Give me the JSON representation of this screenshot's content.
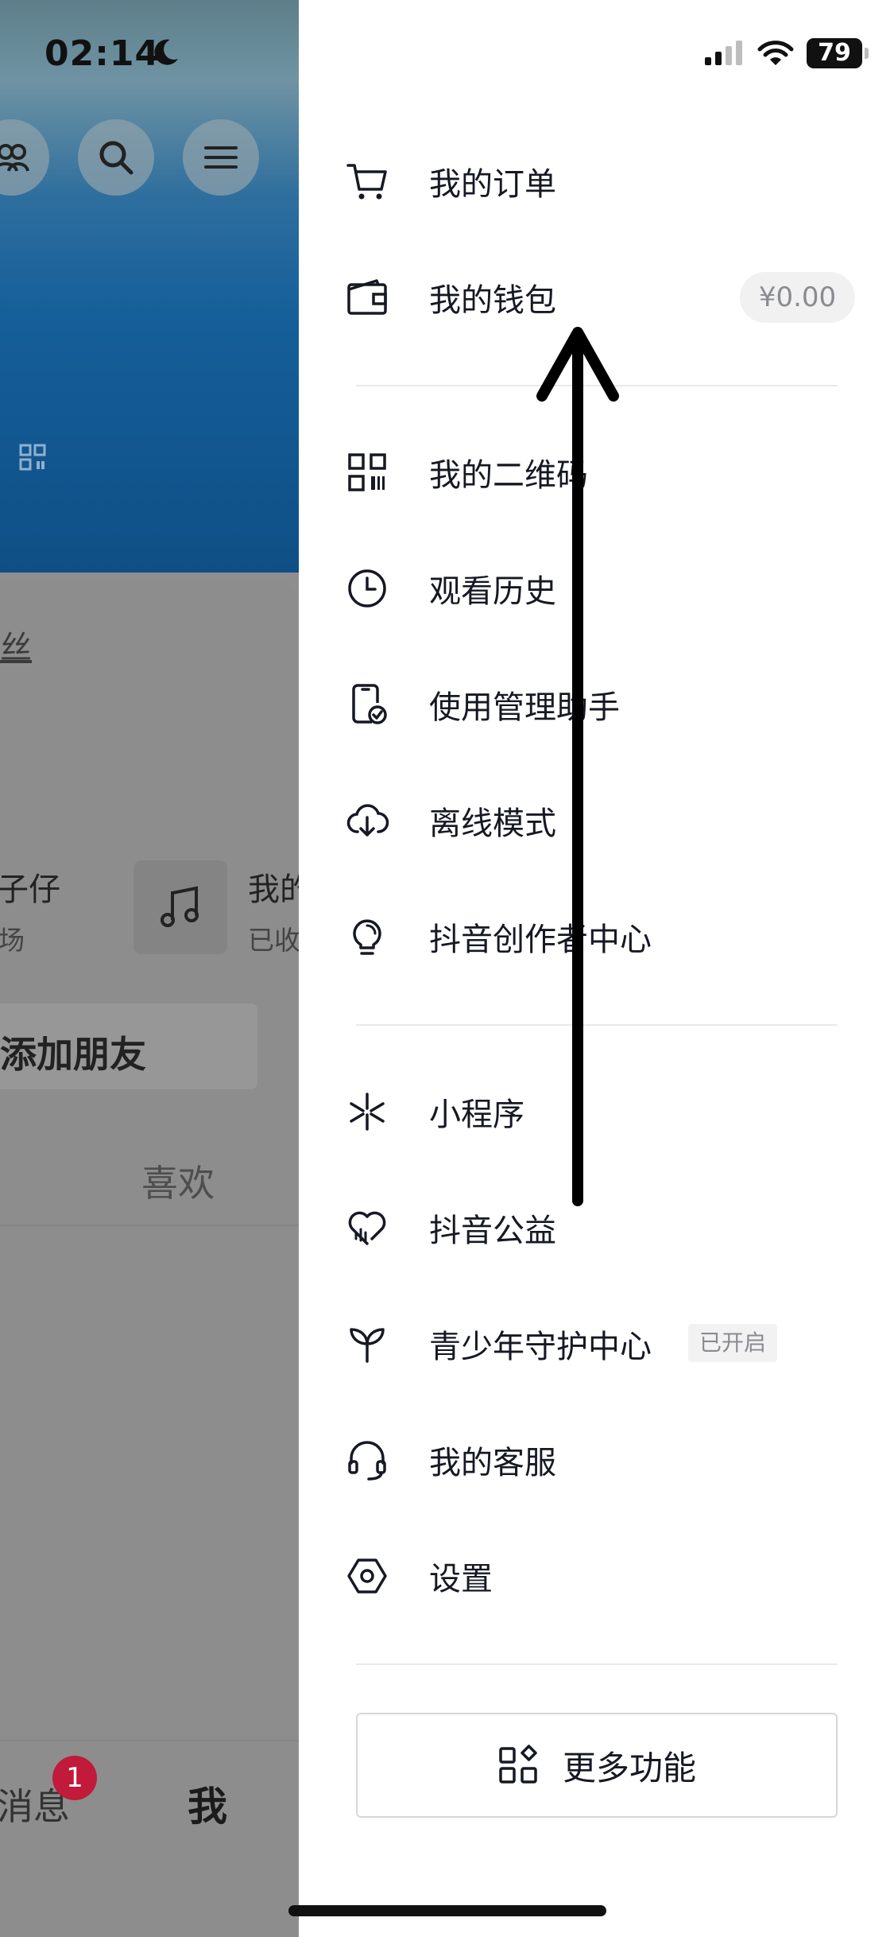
{
  "status_bar": {
    "time": "02:14",
    "battery": "79"
  },
  "background": {
    "fans_fragment": "丝",
    "left_item_title": "子仔",
    "left_item_subtitle": "场",
    "music_title": "我的",
    "music_subtitle": "已收",
    "add_friend_label": "添加朋友",
    "tab_like": "喜欢",
    "nav_message_label": "消息",
    "nav_message_badge": "1",
    "nav_me_label": "我"
  },
  "drawer": {
    "orders": "我的订单",
    "wallet": "我的钱包",
    "wallet_balance": "¥0.00",
    "qr_code": "我的二维码",
    "watch_history": "观看历史",
    "usage_assistant": "使用管理助手",
    "offline_mode": "离线模式",
    "creator_center": "抖音创作者中心",
    "mini_programs": "小程序",
    "charity": "抖音公益",
    "teen_protection": "青少年守护中心",
    "teen_protection_badge": "已开启",
    "customer_service": "我的客服",
    "settings": "设置",
    "more_features": "更多功能"
  },
  "icons": {
    "orders": "cart-icon",
    "wallet": "wallet-icon",
    "qr_code": "qr-code-icon",
    "watch_history": "clock-icon",
    "usage_assistant": "phone-check-icon",
    "offline_mode": "cloud-download-icon",
    "creator_center": "lightbulb-icon",
    "mini_programs": "asterisk-icon",
    "charity": "heart-icon",
    "teen_protection": "sprout-icon",
    "customer_service": "headset-icon",
    "settings": "hexagon-gear-icon",
    "more_features": "grid-plus-icon"
  },
  "colors": {
    "text_primary": "#161823",
    "badge_red": "#c21a3a",
    "divider": "#e9e9ec"
  }
}
